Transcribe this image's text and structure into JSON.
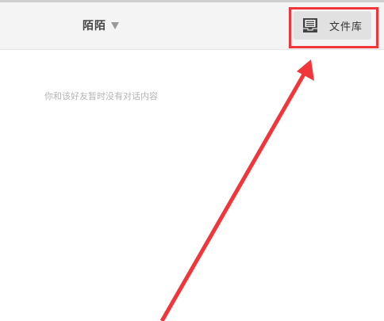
{
  "header": {
    "contact_name": "陌陌",
    "dropdown_icon": "caret-down-icon",
    "library_button": {
      "label": "文件库",
      "icon": "document-icon"
    }
  },
  "conversation": {
    "empty_message": "你和该好友暂时没有对话内容"
  },
  "annotation": {
    "color": "#f0363a",
    "highlight": "library-button",
    "arrow_direction": "up-right"
  },
  "colors": {
    "header_bg": "#f4f4f4",
    "button_bg": "#e1e1e1",
    "placeholder_text": "#b4b4b4"
  }
}
